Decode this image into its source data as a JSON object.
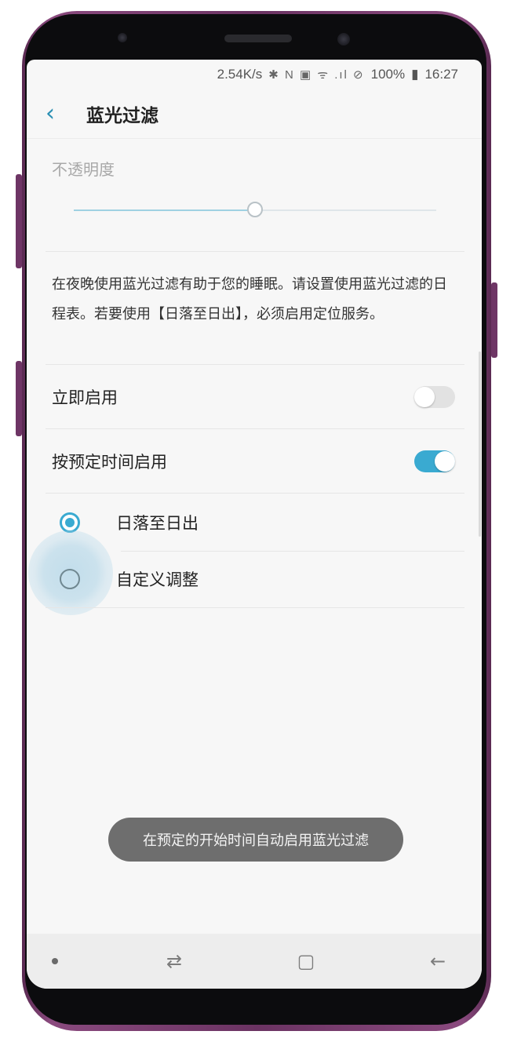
{
  "status_bar": {
    "net_speed": "2.54K/s",
    "icons": "✱ N ▣ ᯤ .ıl ⊘",
    "battery": "100%",
    "time": "16:27"
  },
  "header": {
    "back_icon": "chevron-left-icon",
    "title": "蓝光过滤"
  },
  "opacity": {
    "label": "不透明度",
    "value_fraction": 0.5
  },
  "description": "在夜晚使用蓝光过滤有助于您的睡眠。请设置使用蓝光过滤的日程表。若要使用【日落至日出】，必须启用定位服务。",
  "settings": {
    "enable_now": {
      "label": "立即启用",
      "on": false
    },
    "scheduled": {
      "label": "按预定时间启用",
      "on": true
    }
  },
  "schedule_options": [
    {
      "label": "日落至日出",
      "selected": true
    },
    {
      "label": "自定义调整",
      "selected": false
    }
  ],
  "toast": "在预定的开始时间自动启用蓝光过滤",
  "nav_bar": {
    "left": "nav-dot-icon",
    "recent": "recent-apps-icon",
    "home": "home-icon",
    "back": "back-arrow-icon"
  },
  "colors": {
    "accent": "#3aaad1",
    "phone_body": "#6b3362"
  }
}
